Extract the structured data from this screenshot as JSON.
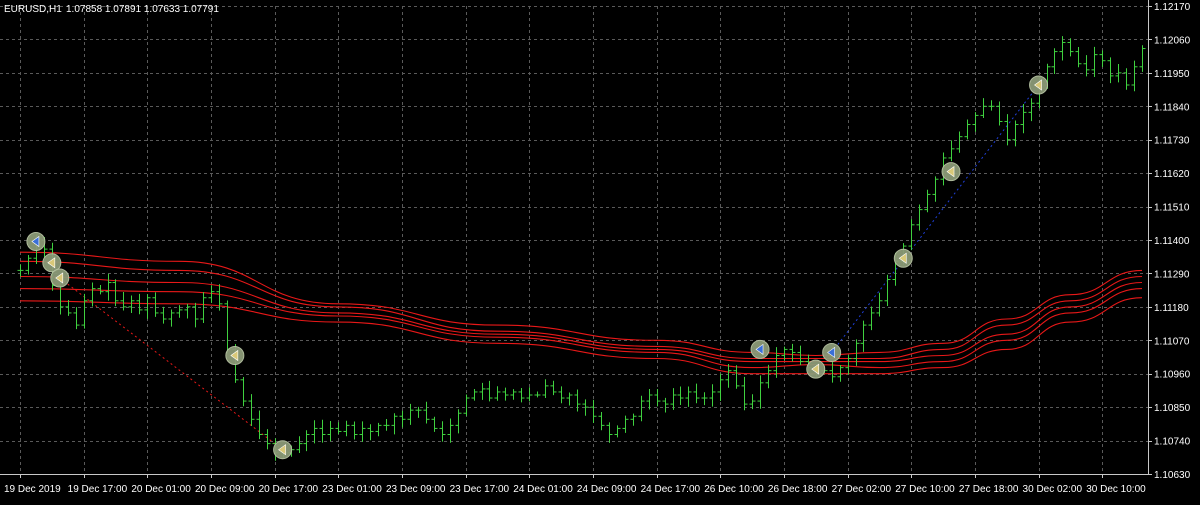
{
  "header": {
    "symbol_label": "EURUSD,H1",
    "ohlc_label": "1.07858 1.07891 1.07633 1.07791"
  },
  "colors": {
    "background": "#000000",
    "grid": "#5a5a5a",
    "axis_text": "#ffffff",
    "bar": "#3fd13f",
    "ma": "#e81818",
    "marker_fill": "#8c9a78",
    "marker_arrow_sell": "#d8c878",
    "marker_arrow_buy": "#3a6fd8",
    "trade_line": "#1f3fd8"
  },
  "chart_data": {
    "type": "ohlc",
    "title": "",
    "xlabel": "",
    "ylabel": "",
    "ylim": [
      1.1063,
      1.1217
    ],
    "yticks": [
      1.1217,
      1.1206,
      1.1195,
      1.1184,
      1.1173,
      1.1162,
      1.1151,
      1.114,
      1.1129,
      1.1118,
      1.1107,
      1.1096,
      1.1085,
      1.1074,
      1.1063
    ],
    "ytick_labels": [
      "1.12170",
      "1.12060",
      "1.11950",
      "1.11840",
      "1.11730",
      "1.11620",
      "1.11510",
      "1.11400",
      "1.11290",
      "1.11180",
      "1.11070",
      "1.10960",
      "1.10850",
      "1.10740",
      "1.10630"
    ],
    "xtick_labels": [
      "19 Dec 2019",
      "19 Dec 17:00",
      "20 Dec 01:00",
      "20 Dec 09:00",
      "20 Dec 17:00",
      "23 Dec 01:00",
      "23 Dec 09:00",
      "23 Dec 17:00",
      "24 Dec 01:00",
      "24 Dec 09:00",
      "24 Dec 17:00",
      "26 Dec 10:00",
      "26 Dec 18:00",
      "27 Dec 02:00",
      "27 Dec 10:00",
      "27 Dec 18:00",
      "30 Dec 02:00",
      "30 Dec 10:00"
    ],
    "x_index_range": [
      0,
      141
    ],
    "xtick_indices": [
      0,
      8,
      16,
      24,
      32,
      40,
      48,
      56,
      64,
      72,
      80,
      88,
      96,
      104,
      112,
      120,
      128,
      136
    ],
    "grid": true,
    "close": [
      1.113,
      1.1134,
      1.114,
      1.1137,
      1.1125,
      1.1118,
      1.1116,
      1.1112,
      1.112,
      1.1124,
      1.1123,
      1.1126,
      1.112,
      1.1118,
      1.112,
      1.1117,
      1.1121,
      1.1116,
      1.1114,
      1.1116,
      1.1117,
      1.1118,
      1.1114,
      1.1121,
      1.1123,
      1.1119,
      1.1104,
      1.1094,
      1.1087,
      1.1081,
      1.1076,
      1.1073,
      1.107,
      1.107,
      1.1071,
      1.1073,
      1.1076,
      1.1078,
      1.1076,
      1.1078,
      1.1077,
      1.1079,
      1.1076,
      1.1078,
      1.1077,
      1.1079,
      1.1079,
      1.1082,
      1.1081,
      1.1084,
      1.1084,
      1.1081,
      1.1078,
      1.1076,
      1.1079,
      1.1083,
      1.1088,
      1.109,
      1.1091,
      1.1088,
      1.109,
      1.1089,
      1.109,
      1.1088,
      1.1089,
      1.1089,
      1.1092,
      1.109,
      1.1088,
      1.1089,
      1.1086,
      1.1085,
      1.1082,
      1.1079,
      1.1076,
      1.1078,
      1.1081,
      1.1082,
      1.1087,
      1.1089,
      1.1087,
      1.1086,
      1.1089,
      1.1088,
      1.109,
      1.1088,
      1.1088,
      1.109,
      1.1094,
      1.1097,
      1.1092,
      1.1086,
      1.1087,
      1.1093,
      1.1097,
      1.1102,
      1.1104,
      1.1103,
      1.11,
      1.1098,
      1.1097,
      1.1097,
      1.1095,
      1.1098,
      1.1101,
      1.1106,
      1.1112,
      1.1116,
      1.112,
      1.1127,
      1.1133,
      1.1138,
      1.1145,
      1.115,
      1.1155,
      1.116,
      1.1167,
      1.117,
      1.1174,
      1.1178,
      1.1181,
      1.1184,
      1.1184,
      1.1179,
      1.1173,
      1.1178,
      1.1182,
      1.1185,
      1.1191,
      1.1197,
      1.1202,
      1.1205,
      1.1202,
      1.1198,
      1.1196,
      1.1201,
      1.1199,
      1.1194,
      1.1195,
      1.1191,
      1.1197,
      1.1203
    ],
    "moving_averages": [
      {
        "label": "",
        "points": [
          [
            0,
            1.1136
          ],
          [
            20,
            1.1133
          ],
          [
            40,
            1.1119
          ],
          [
            60,
            1.1112
          ],
          [
            80,
            1.1107
          ],
          [
            92,
            1.1103
          ],
          [
            100,
            1.1102
          ],
          [
            108,
            1.1103
          ],
          [
            116,
            1.1106
          ],
          [
            124,
            1.1114
          ],
          [
            132,
            1.1122
          ],
          [
            141,
            1.113
          ]
        ]
      },
      {
        "label": "",
        "points": [
          [
            0,
            1.1133
          ],
          [
            20,
            1.113
          ],
          [
            40,
            1.1118
          ],
          [
            60,
            1.111
          ],
          [
            80,
            1.1105
          ],
          [
            92,
            1.1101
          ],
          [
            100,
            1.1101
          ],
          [
            108,
            1.1101
          ],
          [
            116,
            1.1104
          ],
          [
            124,
            1.1112
          ],
          [
            132,
            1.112
          ],
          [
            141,
            1.1128
          ]
        ]
      },
      {
        "label": "",
        "points": [
          [
            0,
            1.1128
          ],
          [
            20,
            1.1126
          ],
          [
            40,
            1.1116
          ],
          [
            60,
            1.1109
          ],
          [
            80,
            1.1104
          ],
          [
            92,
            1.11
          ],
          [
            100,
            1.11
          ],
          [
            108,
            1.11
          ],
          [
            116,
            1.1102
          ],
          [
            124,
            1.1109
          ],
          [
            132,
            1.1118
          ],
          [
            141,
            1.1126
          ]
        ]
      },
      {
        "label": "",
        "points": [
          [
            0,
            1.1124
          ],
          [
            20,
            1.1123
          ],
          [
            40,
            1.1115
          ],
          [
            60,
            1.1108
          ],
          [
            80,
            1.1103
          ],
          [
            92,
            1.1098
          ],
          [
            100,
            1.1099
          ],
          [
            108,
            1.1098
          ],
          [
            116,
            1.11
          ],
          [
            124,
            1.1107
          ],
          [
            132,
            1.1116
          ],
          [
            141,
            1.1124
          ]
        ]
      },
      {
        "label": "",
        "points": [
          [
            0,
            1.112
          ],
          [
            20,
            1.1119
          ],
          [
            40,
            1.1113
          ],
          [
            60,
            1.1106
          ],
          [
            80,
            1.1101
          ],
          [
            92,
            1.1096
          ],
          [
            100,
            1.1096
          ],
          [
            108,
            1.1096
          ],
          [
            116,
            1.1098
          ],
          [
            124,
            1.1104
          ],
          [
            132,
            1.1113
          ],
          [
            141,
            1.1121
          ]
        ]
      }
    ],
    "trade_markers": [
      {
        "x": 2,
        "y": 1.11395,
        "kind": "buy"
      },
      {
        "x": 4,
        "y": 1.11325,
        "kind": "sell"
      },
      {
        "x": 5,
        "y": 1.11275,
        "kind": "sell"
      },
      {
        "x": 27,
        "y": 1.1102,
        "kind": "sell"
      },
      {
        "x": 33,
        "y": 1.1071,
        "kind": "sell"
      },
      {
        "x": 93,
        "y": 1.1104,
        "kind": "buy"
      },
      {
        "x": 100,
        "y": 1.10975,
        "kind": "sell"
      },
      {
        "x": 102,
        "y": 1.1103,
        "kind": "buy"
      },
      {
        "x": 111,
        "y": 1.1134,
        "kind": "sell"
      },
      {
        "x": 117,
        "y": 1.11625,
        "kind": "sell"
      },
      {
        "x": 128,
        "y": 1.1191,
        "kind": "sell"
      }
    ],
    "trade_lines": [
      {
        "from": [
          5,
          1.11275
        ],
        "to": [
          33,
          1.1071
        ],
        "color": "#e81818"
      },
      {
        "from": [
          102,
          1.1103
        ],
        "to": [
          128,
          1.1191
        ],
        "color": "#1f3fd8"
      }
    ]
  }
}
